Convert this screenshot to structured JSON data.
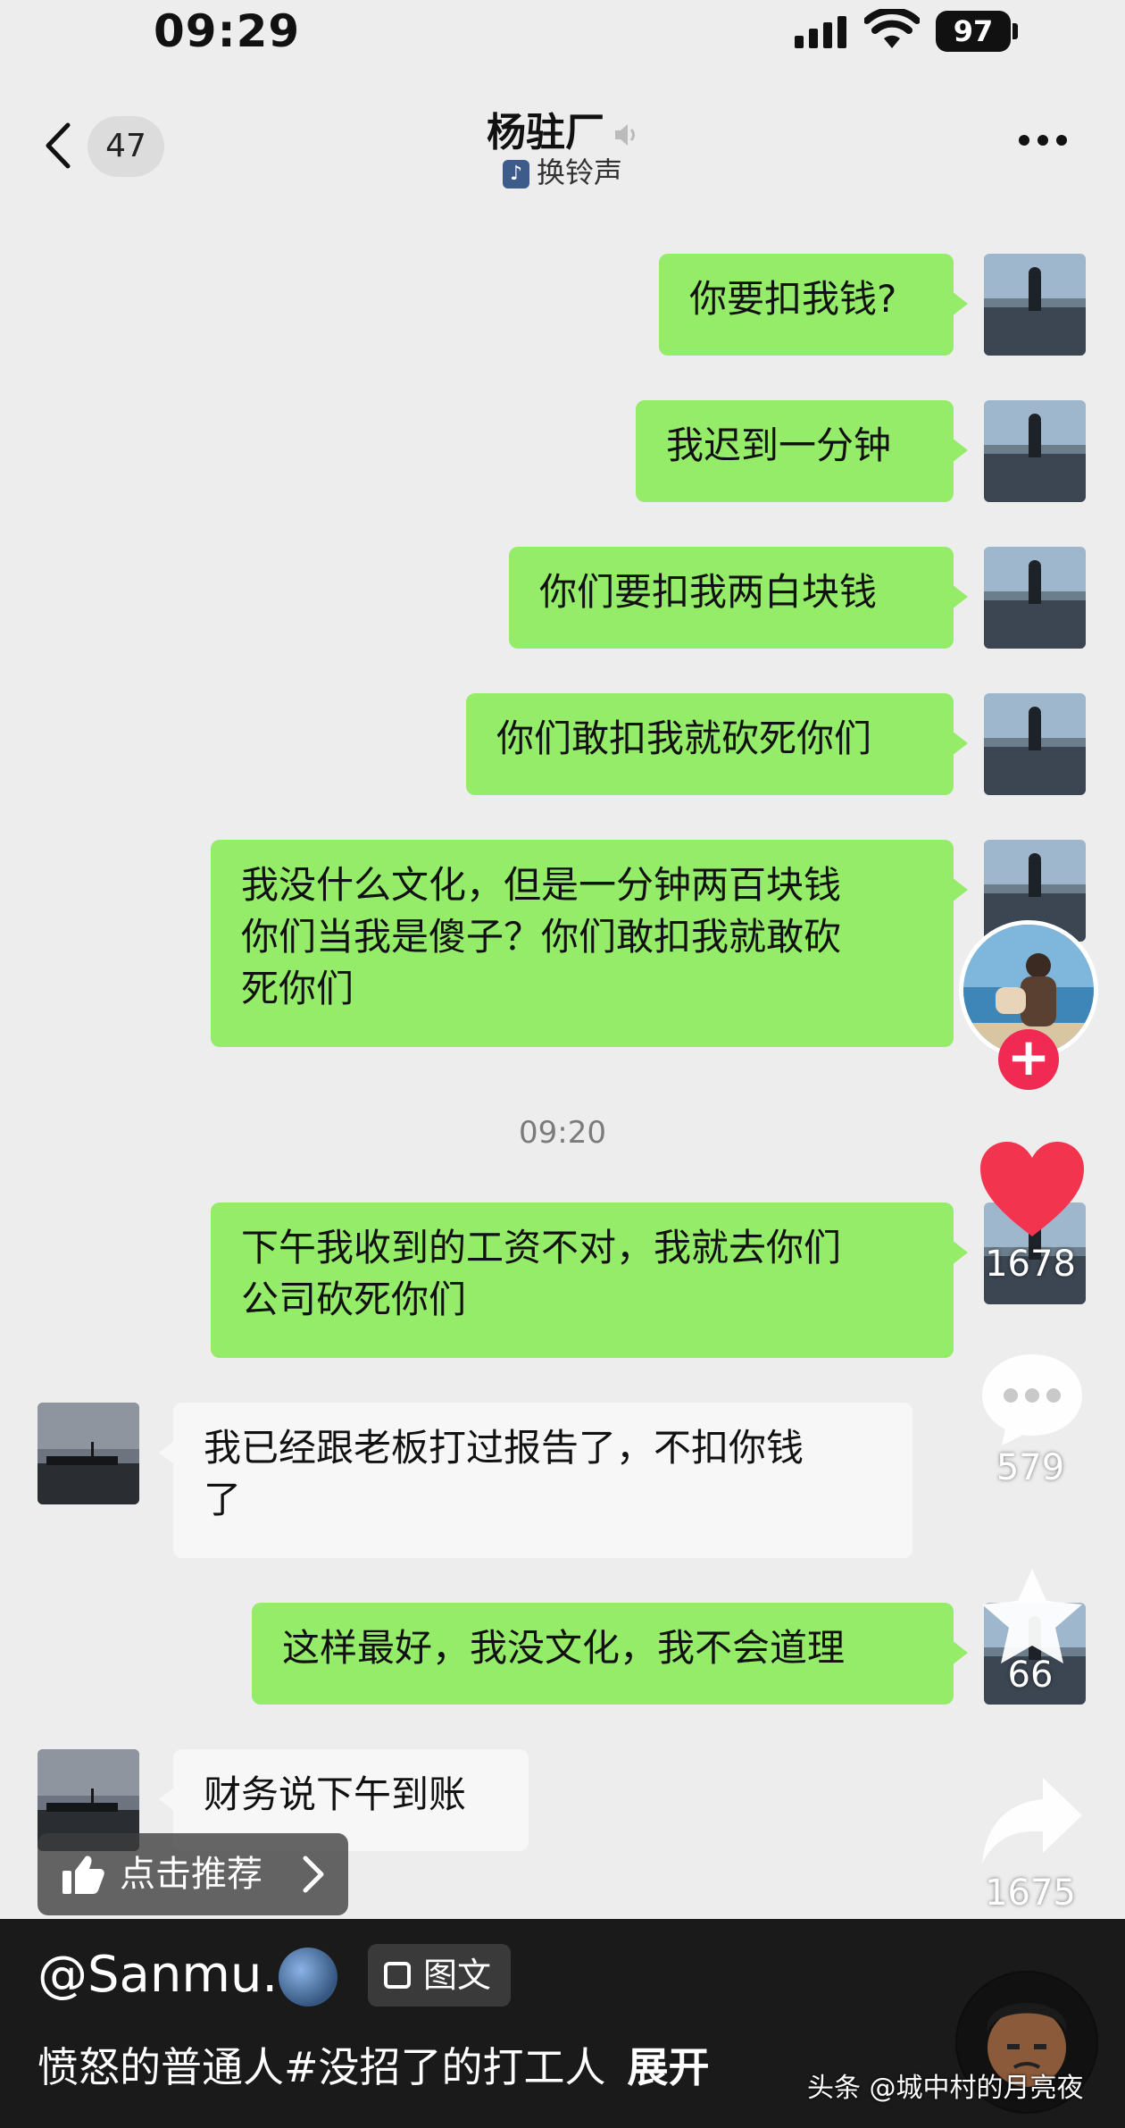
{
  "status_bar": {
    "time": "09:29",
    "battery": "97"
  },
  "header": {
    "back_count": "47",
    "title": "杨驻厂",
    "subtitle": "换铃声"
  },
  "messages": [
    {
      "side": "me",
      "text": "你要扣我钱?"
    },
    {
      "side": "me",
      "text": "我迟到一分钟"
    },
    {
      "side": "me",
      "text": "你们要扣我两白块钱"
    },
    {
      "side": "me",
      "text": "你们敢扣我就砍死你们"
    },
    {
      "side": "me",
      "lines": [
        "我没什么文化，但是一分钟两百块钱",
        "你们当我是傻子？你们敢扣我就敢砍",
        "死你们"
      ]
    },
    {
      "side": "time",
      "text": "09:20"
    },
    {
      "side": "me",
      "lines": [
        "下午我收到的工资不对，我就去你们",
        "公司砍死你们"
      ]
    },
    {
      "side": "other",
      "lines": [
        "我已经跟老板打过报告了，不扣你钱",
        "了"
      ]
    },
    {
      "side": "me",
      "text": "这样最好，我没文化，我不会道理"
    },
    {
      "side": "other",
      "text": "财务说下午到账"
    }
  ],
  "rail": {
    "likes": "1678",
    "comments": "579",
    "favorites": "66",
    "shares": "1675",
    "follow_symbol": "+"
  },
  "recommend_label": "点击推荐",
  "post": {
    "username": "@Sanmu.",
    "tag": "图文",
    "caption": "愤怒的普通人#没招了的打工人",
    "expand": "展开"
  },
  "watermark": "头条 @城中村的月亮夜",
  "colors": {
    "chat_bg": "#ededed",
    "my_bubble": "#95ec69",
    "other_bubble": "#f7f7f7",
    "like_red": "#f2344f",
    "follow_red": "#f02a52"
  }
}
